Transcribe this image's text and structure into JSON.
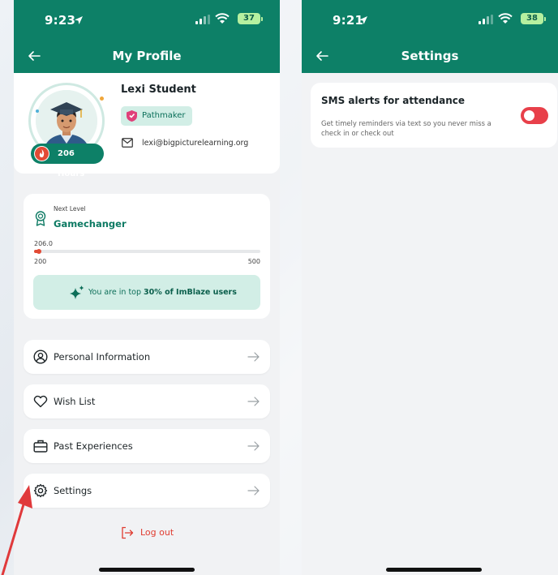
{
  "left_screen": {
    "status_bar": {
      "time": "9:23",
      "battery": "37"
    },
    "nav": {
      "title": "My Profile",
      "back_icon": "arrow-left-icon"
    },
    "profile": {
      "name": "Lexi Student",
      "badge": "Pathmaker",
      "hours": "206 Hours",
      "email": "lexi@bigpicturelearning.org"
    },
    "level": {
      "next_level_label": "Next Level",
      "next_level_name": "Gamechanger",
      "progress_value": "206.0",
      "progress_min": "200",
      "progress_max": "500",
      "progress_current": 206,
      "rank_text_prefix": "You are in top ",
      "rank_text_bold": "30% of ImBlaze users"
    },
    "menu": [
      {
        "label": "Personal Information",
        "icon": "user-circle-icon"
      },
      {
        "label": "Wish List",
        "icon": "heart-icon"
      },
      {
        "label": "Past Experiences",
        "icon": "briefcase-icon"
      },
      {
        "label": "Settings",
        "icon": "gear-icon"
      }
    ],
    "logout_label": "Log out"
  },
  "right_screen": {
    "status_bar": {
      "time": "9:21",
      "battery": "38"
    },
    "nav": {
      "title": "Settings",
      "back_icon": "arrow-left-icon"
    },
    "sms_alerts": {
      "title": "SMS alerts for attendance",
      "description": "Get timely reminders via text so you never miss a check in or check out",
      "enabled": false
    }
  },
  "colors": {
    "brand_green": "#0d8067",
    "accent_red": "#e24a35",
    "toggle_red": "#e8404a",
    "pill_green": "#d2eee6"
  }
}
